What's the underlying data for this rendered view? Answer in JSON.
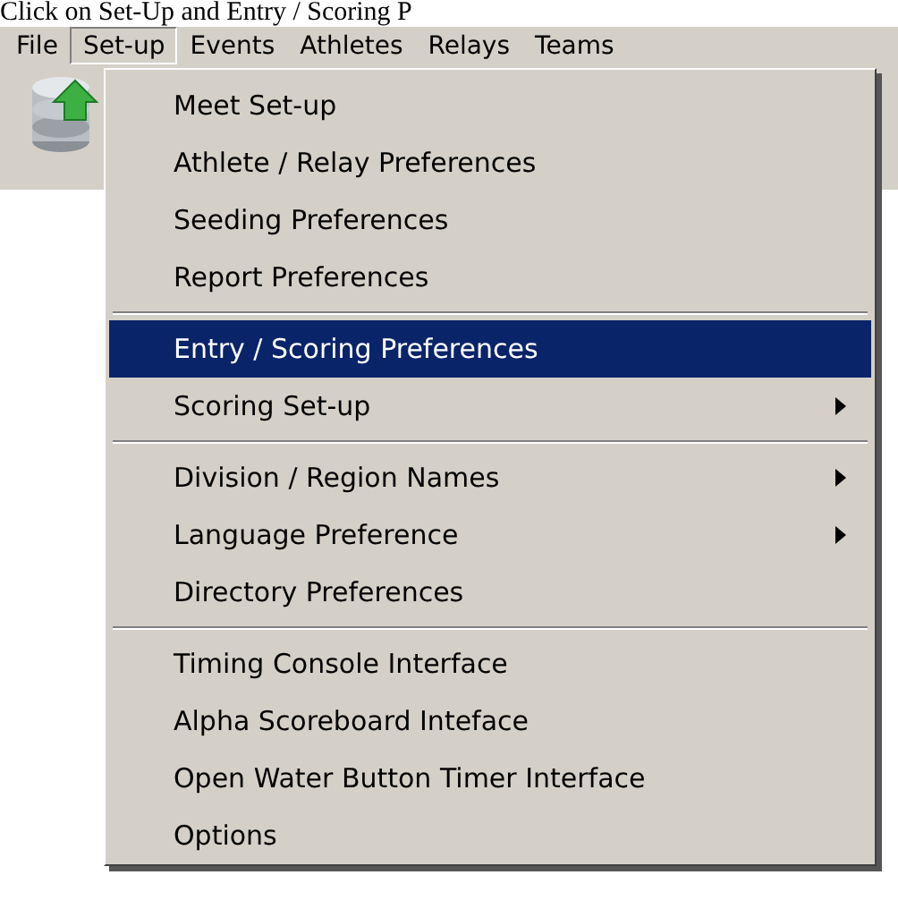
{
  "caption": "Click on Set-Up and Entry / Scoring P",
  "menubar": [
    {
      "label": "File",
      "selected": false
    },
    {
      "label": "Set-up",
      "selected": true
    },
    {
      "label": "Events",
      "selected": false
    },
    {
      "label": "Athletes",
      "selected": false
    },
    {
      "label": "Relays",
      "selected": false
    },
    {
      "label": "Teams",
      "selected": false
    }
  ],
  "menu": [
    {
      "kind": "item",
      "label": "Meet Set-up",
      "selected": false,
      "submenu": false
    },
    {
      "kind": "item",
      "label": "Athlete / Relay Preferences",
      "selected": false,
      "submenu": false
    },
    {
      "kind": "item",
      "label": "Seeding Preferences",
      "selected": false,
      "submenu": false
    },
    {
      "kind": "item",
      "label": "Report Preferences",
      "selected": false,
      "submenu": false
    },
    {
      "kind": "separator"
    },
    {
      "kind": "item",
      "label": "Entry / Scoring Preferences",
      "selected": true,
      "submenu": false
    },
    {
      "kind": "item",
      "label": "Scoring Set-up",
      "selected": false,
      "submenu": true
    },
    {
      "kind": "separator"
    },
    {
      "kind": "item",
      "label": "Division / Region Names",
      "selected": false,
      "submenu": true
    },
    {
      "kind": "item",
      "label": "Language Preference",
      "selected": false,
      "submenu": true
    },
    {
      "kind": "item",
      "label": "Directory Preferences",
      "selected": false,
      "submenu": false
    },
    {
      "kind": "separator"
    },
    {
      "kind": "item",
      "label": "Timing Console Interface",
      "selected": false,
      "submenu": false
    },
    {
      "kind": "item",
      "label": "Alpha Scoreboard Inteface",
      "selected": false,
      "submenu": false
    },
    {
      "kind": "item",
      "label": "Open Water Button Timer Interface",
      "selected": false,
      "submenu": false
    },
    {
      "kind": "item",
      "label": "Options",
      "selected": false,
      "submenu": false
    }
  ]
}
